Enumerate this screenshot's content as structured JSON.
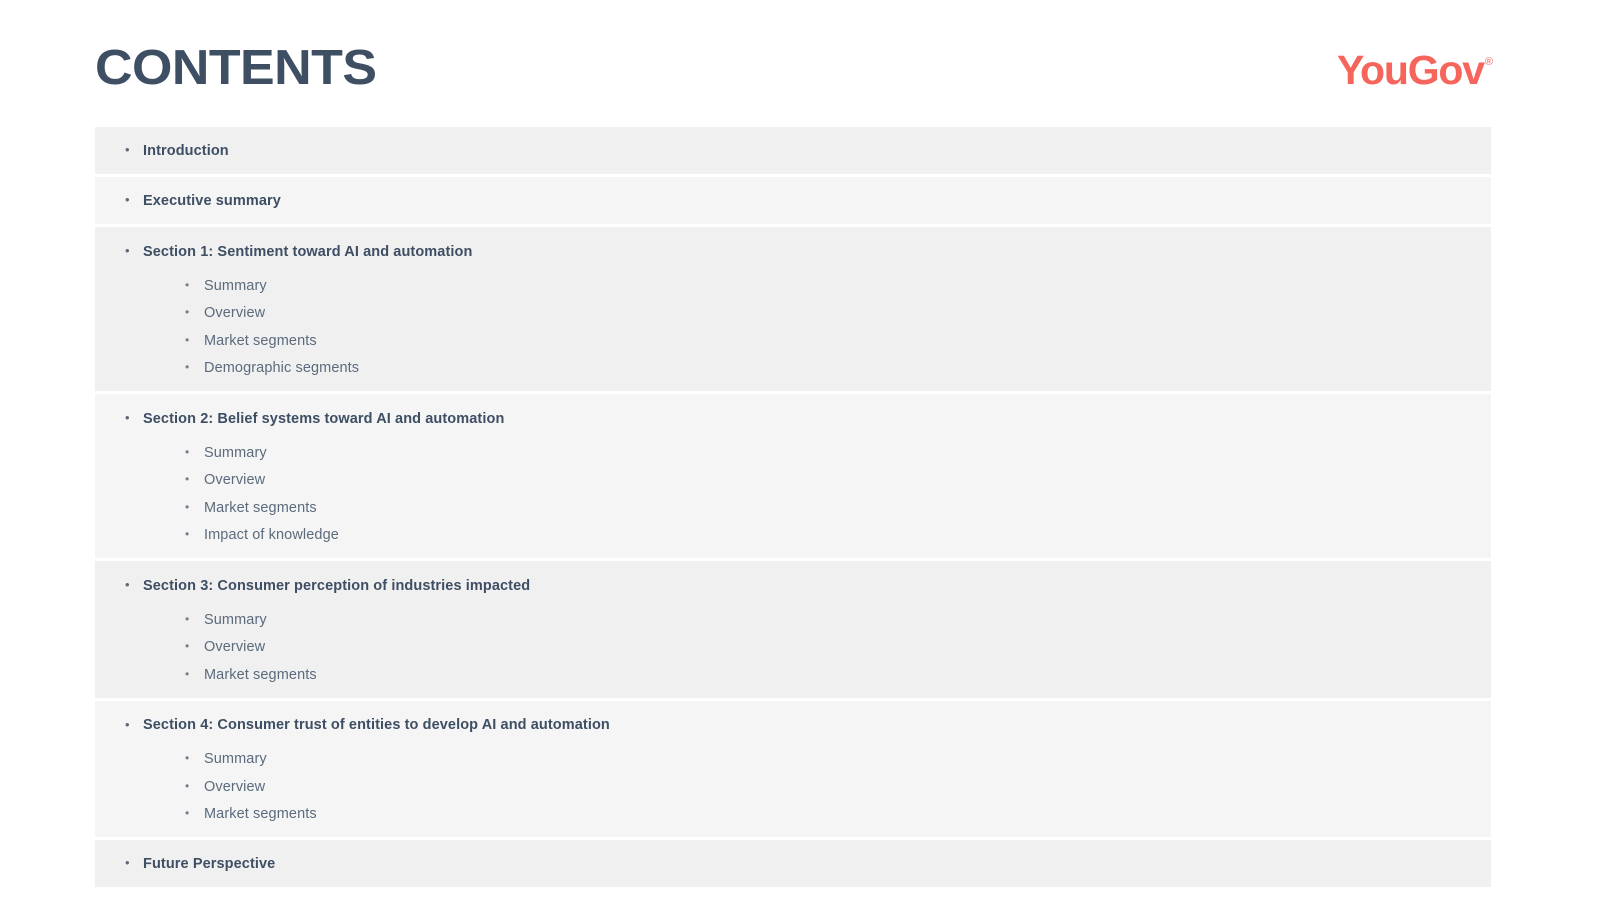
{
  "page": {
    "title": "CONTENTS",
    "background_color": "#ffffff",
    "title_color": "#3e4e63"
  },
  "logo": {
    "text": "YouGov",
    "registered_mark": "®",
    "color": "#f5655b",
    "icon": "yougov-logo"
  },
  "bullets": {
    "main": "•",
    "sub": "•"
  },
  "colors": {
    "row_shade_a": "#f0f0f1",
    "row_shade_b": "#f5f5f6",
    "main_text": "#3e4e63",
    "sub_text": "#5b6b7c",
    "accent": "#f5655b"
  },
  "contents": [
    {
      "label": "Introduction",
      "shade": "a",
      "children": []
    },
    {
      "label": "Executive summary",
      "shade": "b",
      "children": []
    },
    {
      "label": "Section 1: Sentiment toward AI and automation",
      "shade": "a",
      "children": [
        "Summary",
        "Overview",
        "Market segments",
        "Demographic segments"
      ]
    },
    {
      "label": "Section 2: Belief systems toward AI and automation",
      "shade": "b",
      "children": [
        "Summary",
        "Overview",
        "Market segments",
        "Impact of knowledge"
      ]
    },
    {
      "label": "Section 3: Consumer perception of industries impacted",
      "shade": "a",
      "children": [
        "Summary",
        "Overview",
        "Market segments"
      ]
    },
    {
      "label": "Section 4: Consumer trust of entities to develop AI and automation",
      "shade": "b",
      "children": [
        "Summary",
        "Overview",
        "Market segments"
      ]
    },
    {
      "label": "Future Perspective",
      "shade": "a",
      "children": []
    }
  ]
}
